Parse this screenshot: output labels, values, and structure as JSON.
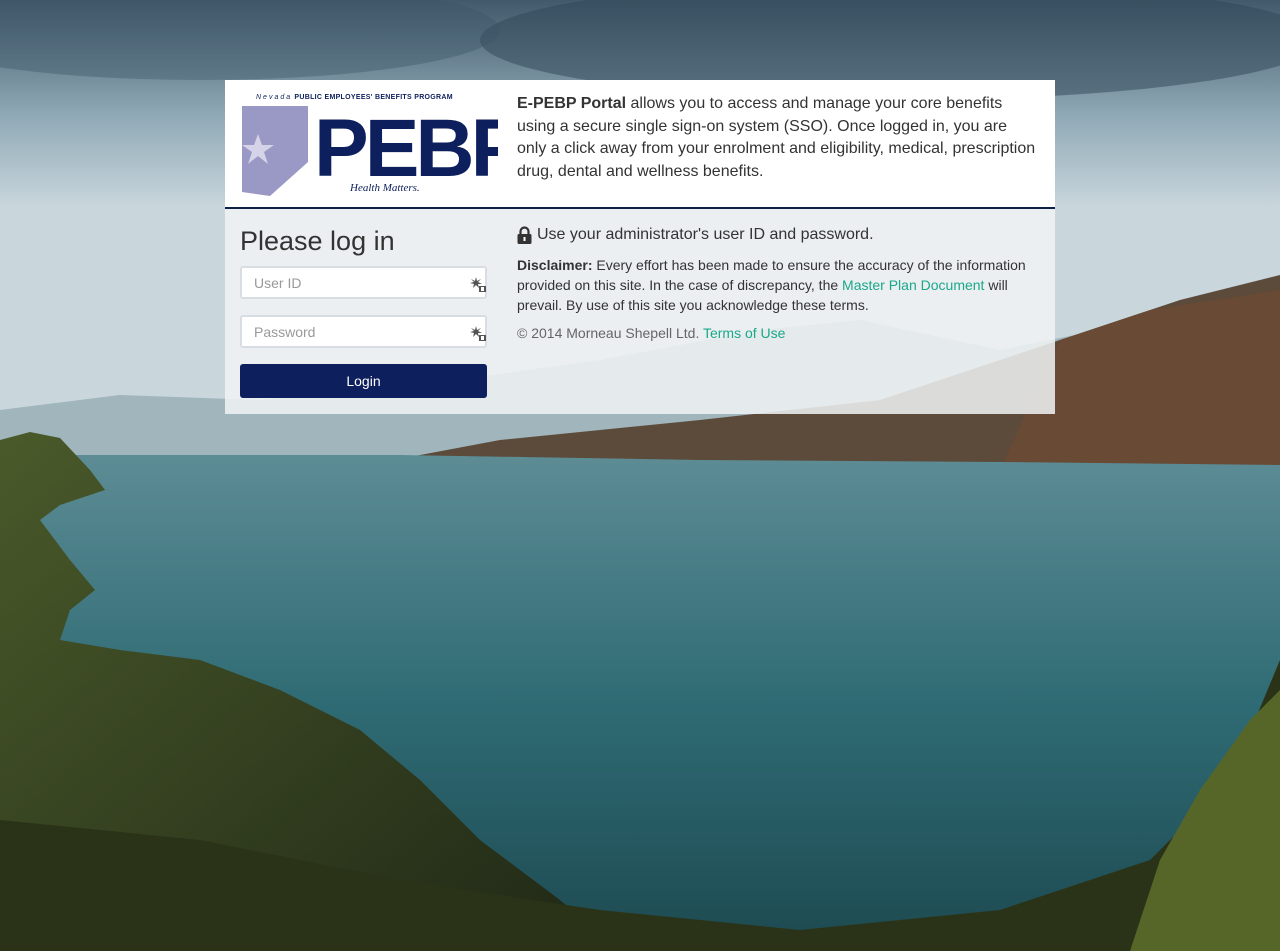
{
  "logo": {
    "tagline_state": "Nevada",
    "tagline_program": "PUBLIC EMPLOYEES' BENEFITS PROGRAM",
    "wordmark": "PEBP",
    "slogan": "Health Matters."
  },
  "intro": {
    "product_name": "E-PEBP Portal",
    "text": " allows you to access and manage your core benefits using a secure single sign-on system (SSO). Once logged in, you are only a click away from your enrolment and eligibility, medical, prescription drug, dental and wellness benefits."
  },
  "login": {
    "title": "Please log in",
    "user_id_placeholder": "User ID",
    "password_placeholder": "Password",
    "button_label": "Login"
  },
  "admin_note": "Use your administrator's user ID and password.",
  "disclaimer": {
    "label": "Disclaimer:",
    "text_before": " Every effort has been made to ensure the accuracy of the information provided on this site. In the case of discrepancy, the ",
    "link_text": "Master Plan Document",
    "text_after": " will prevail. By use of this site you acknowledge these terms."
  },
  "footer": {
    "copyright": "© 2014 Morneau Shepell Ltd.",
    "terms_link": "Terms of Use"
  },
  "icons": {
    "lock": "lock-icon",
    "field": "key-asterisk-icon",
    "logo_star": "star-icon"
  },
  "colors": {
    "brand_navy": "#0d1f5c",
    "link_green": "#1aa88a",
    "logo_lavender": "#9a98c4"
  }
}
